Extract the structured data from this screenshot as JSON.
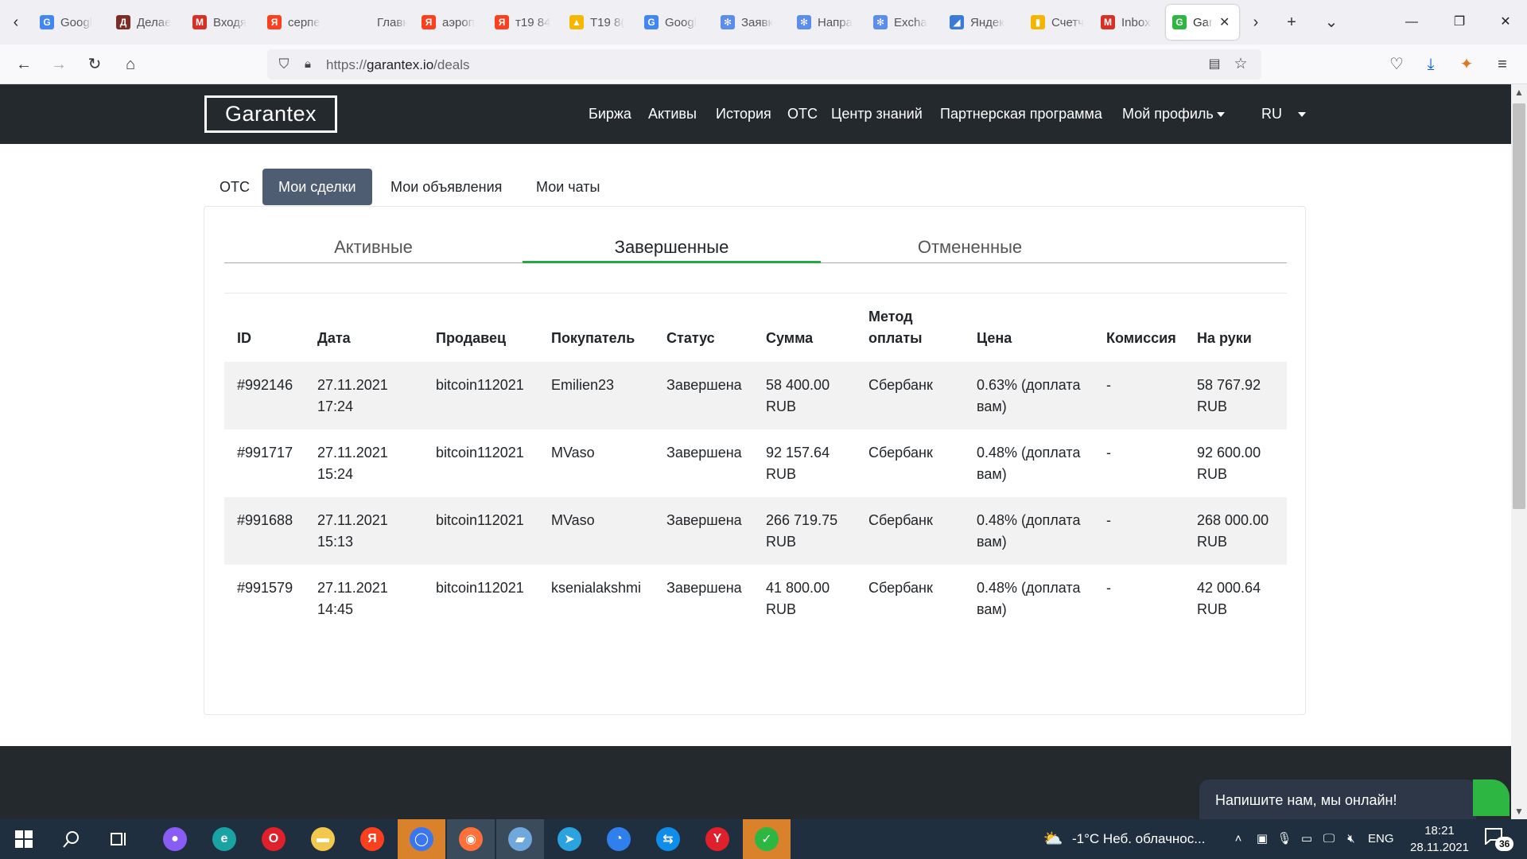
{
  "browser": {
    "tabs": [
      {
        "label": "Googl",
        "icon": "google-docs-icon",
        "color": "#4285f4",
        "glyph": "G"
      },
      {
        "label": "Делае",
        "icon": "book-icon",
        "color": "#7b2d26",
        "glyph": "Д"
      },
      {
        "label": "Входя",
        "icon": "gmail-icon",
        "color": "#d93025",
        "glyph": "M"
      },
      {
        "label": "серпе",
        "icon": "yandex-icon",
        "color": "#fc3f1d",
        "glyph": "Я"
      },
      {
        "label": "Главн",
        "icon": "blank-icon",
        "color": "#f0f0f4",
        "glyph": ""
      },
      {
        "label": "аэроп",
        "icon": "yandex-icon",
        "color": "#fc3f1d",
        "glyph": "Я"
      },
      {
        "label": "т19 84",
        "icon": "yandex-icon",
        "color": "#fc3f1d",
        "glyph": "Я"
      },
      {
        "label": "T19 8(",
        "icon": "warning-icon",
        "color": "#f5b700",
        "glyph": "▲"
      },
      {
        "label": "Googl",
        "icon": "google-docs-icon",
        "color": "#4285f4",
        "glyph": "G"
      },
      {
        "label": "Заявк",
        "icon": "gear-icon",
        "color": "#5b8def",
        "glyph": "✻"
      },
      {
        "label": "Напра",
        "icon": "gear-icon",
        "color": "#5b8def",
        "glyph": "✻"
      },
      {
        "label": "Excha",
        "icon": "gear-icon",
        "color": "#5b8def",
        "glyph": "✻"
      },
      {
        "label": "Яндек",
        "icon": "yandex-browser-icon",
        "color": "#3a7bd5",
        "glyph": "◢"
      },
      {
        "label": "Счетч",
        "icon": "metrica-icon",
        "color": "#f4b400",
        "glyph": "▮"
      },
      {
        "label": "Inbox",
        "icon": "gmail-icon",
        "color": "#d93025",
        "glyph": "M"
      },
      {
        "label": "Gar",
        "icon": "garantex-icon",
        "color": "#2db742",
        "glyph": "G",
        "active": true
      }
    ],
    "close_glyph": "✕",
    "new_tab_glyph": "+",
    "list_tabs_glyph": "⌄",
    "url_host_prefix": "https://",
    "url_host": "garantex.io",
    "url_path": "/deals"
  },
  "site": {
    "logo": "Garantex",
    "nav": [
      "Биржа",
      "Активы",
      "История",
      "OTC",
      "Центр знаний",
      "Партнерская программа"
    ],
    "profile": "Мой профиль",
    "lang": "RU"
  },
  "page": {
    "tabs": [
      "OTC",
      "Мои сделки",
      "Мои объявления",
      "Мои чаты"
    ],
    "active_tab": "Мои сделки",
    "subtabs": [
      "Активные",
      "Завершенные",
      "Отмененные"
    ],
    "active_subtab": "Завершенные",
    "table": {
      "headers": [
        "ID",
        "Дата",
        "Продавец",
        "Покупатель",
        "Статус",
        "Сумма",
        "Метод оплаты",
        "Цена",
        "Комиссия",
        "На руки"
      ],
      "rows": [
        {
          "id": "#992146",
          "date": "27.11.2021 17:24",
          "seller": "bitcoin112021",
          "buyer": "Emilien23",
          "status": "Завершена",
          "amount": "58 400.00 RUB",
          "method": "Сбербанк",
          "price": "0.63% (доплата вам)",
          "fee": "-",
          "net": "58 767.92 RUB"
        },
        {
          "id": "#991717",
          "date": "27.11.2021 15:24",
          "seller": "bitcoin112021",
          "buyer": "MVaso",
          "status": "Завершена",
          "amount": "92 157.64 RUB",
          "method": "Сбербанк",
          "price": "0.48% (доплата вам)",
          "fee": "-",
          "net": "92 600.00 RUB"
        },
        {
          "id": "#991688",
          "date": "27.11.2021 15:13",
          "seller": "bitcoin112021",
          "buyer": "MVaso",
          "status": "Завершена",
          "amount": "266 719.75 RUB",
          "method": "Сбербанк",
          "price": "0.48% (доплата вам)",
          "fee": "-",
          "net": "268 000.00 RUB"
        },
        {
          "id": "#991579",
          "date": "27.11.2021 14:45",
          "seller": "bitcoin112021",
          "buyer": "ksenialakshmi",
          "status": "Завершена",
          "amount": "41 800.00 RUB",
          "method": "Сбербанк",
          "price": "0.48% (доплата вам)",
          "fee": "-",
          "net": "42 000.64 RUB"
        }
      ]
    }
  },
  "chat_widget": {
    "text": "Напишите нам, мы онлайн!"
  },
  "taskbar": {
    "weather": "-1°C  Неб. облачнос...",
    "lang": "ENG",
    "time": "18:21",
    "date": "28.11.2021",
    "notifications": "36",
    "apps": [
      {
        "name": "alice-icon",
        "color": "#8a5cf6",
        "glyph": "●"
      },
      {
        "name": "edge-icon",
        "color": "#1aa3a3",
        "glyph": "e"
      },
      {
        "name": "opera-icon",
        "color": "#e0202a",
        "glyph": "O"
      },
      {
        "name": "explorer-icon",
        "color": "#f2c94c",
        "glyph": "▬"
      },
      {
        "name": "yandex-browser-icon",
        "color": "#fc3f1d",
        "glyph": "Я"
      },
      {
        "name": "signal-icon",
        "color": "#3a76f0",
        "glyph": "◯"
      },
      {
        "name": "firefox-icon",
        "color": "#ff7139",
        "glyph": "◉"
      },
      {
        "name": "notepad-icon",
        "color": "#6fa8dc",
        "glyph": "▰"
      },
      {
        "name": "telegram-icon",
        "color": "#2aa3e0",
        "glyph": "➤"
      },
      {
        "name": "speedtest-icon",
        "color": "#2f80ed",
        "glyph": "◔"
      },
      {
        "name": "teamviewer-icon",
        "color": "#0e8ee9",
        "glyph": "⇆"
      },
      {
        "name": "yandex-icon",
        "color": "#e0202a",
        "glyph": "Y"
      },
      {
        "name": "antivirus-icon",
        "color": "#2db742",
        "glyph": "✓"
      }
    ]
  }
}
